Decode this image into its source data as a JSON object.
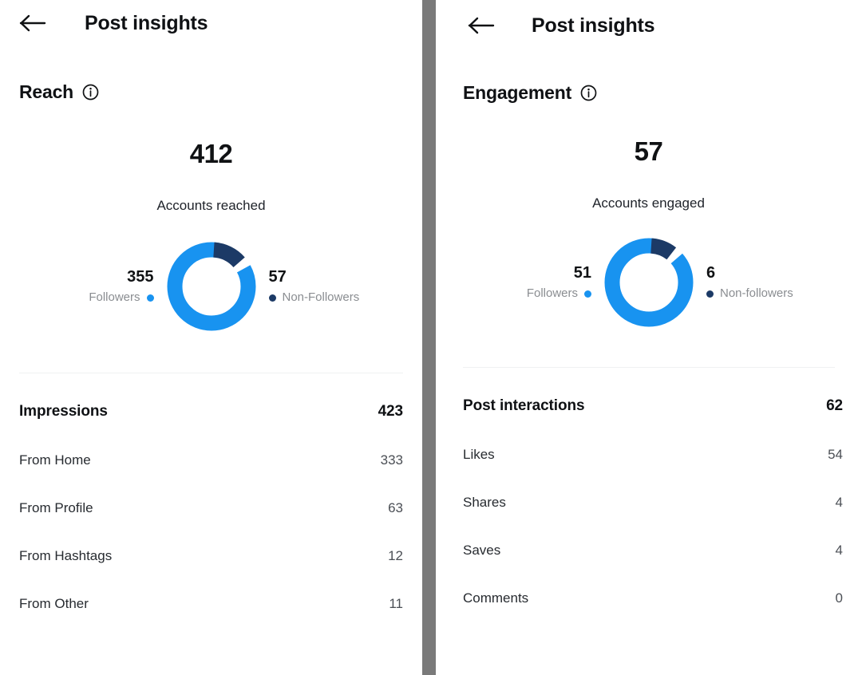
{
  "colors": {
    "followers": "#1893f0",
    "non_followers": "#1c3a66",
    "divider_strip": "#7a7a7a",
    "hairline": "#f0f1f2",
    "text_primary": "#0f1114",
    "text_muted": "#8a8d91"
  },
  "left_panel": {
    "topbar": {
      "back_icon": "arrow-left-icon",
      "title": "Post insights"
    },
    "section": {
      "title": "Reach",
      "info_icon": "info-circle-icon"
    },
    "metric": {
      "value": "412",
      "label": "Accounts reached"
    },
    "legend": {
      "followers": {
        "value": "355",
        "label": "Followers"
      },
      "non_followers": {
        "value": "57",
        "label": "Non-Followers"
      }
    },
    "list": {
      "head_label": "Impressions",
      "head_value": "423",
      "rows": [
        {
          "label": "From Home",
          "value": "333"
        },
        {
          "label": "From Profile",
          "value": "63"
        },
        {
          "label": "From Hashtags",
          "value": "12"
        },
        {
          "label": "From Other",
          "value": "11"
        }
      ]
    }
  },
  "right_panel": {
    "topbar": {
      "back_icon": "arrow-left-icon",
      "title": "Post insights"
    },
    "section": {
      "title": "Engagement",
      "info_icon": "info-circle-icon"
    },
    "metric": {
      "value": "57",
      "label": "Accounts engaged"
    },
    "legend": {
      "followers": {
        "value": "51",
        "label": "Followers"
      },
      "non_followers": {
        "value": "6",
        "label": "Non-followers"
      }
    },
    "list": {
      "head_label": "Post interactions",
      "head_value": "62",
      "rows": [
        {
          "label": "Likes",
          "value": "54"
        },
        {
          "label": "Shares",
          "value": "4"
        },
        {
          "label": "Saves",
          "value": "4"
        },
        {
          "label": "Comments",
          "value": "0"
        }
      ]
    }
  },
  "chart_data": [
    {
      "type": "pie",
      "title": "Reach",
      "subtitle": "Accounts reached",
      "total": 412,
      "categories": [
        "Followers",
        "Non-Followers"
      ],
      "values": [
        355,
        57
      ],
      "colors": [
        "#1893f0",
        "#1c3a66"
      ],
      "percentages": [
        86.2,
        13.8
      ],
      "legend": "sides",
      "donut": true
    },
    {
      "type": "pie",
      "title": "Engagement",
      "subtitle": "Accounts engaged",
      "total": 57,
      "categories": [
        "Followers",
        "Non-followers"
      ],
      "values": [
        51,
        6
      ],
      "colors": [
        "#1893f0",
        "#1c3a66"
      ],
      "percentages": [
        89.5,
        10.5
      ],
      "legend": "sides",
      "donut": true
    }
  ]
}
